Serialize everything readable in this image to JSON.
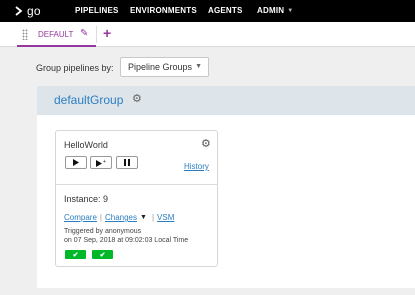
{
  "nav": {
    "logo_text": "go",
    "items": [
      "PIPELINES",
      "ENVIRONMENTS",
      "AGENTS"
    ],
    "admin_label": "ADMIN"
  },
  "tabs": {
    "default_label": "DEFAULT",
    "add_symbol": "+"
  },
  "group_by": {
    "label": "Group pipelines by:",
    "selected": "Pipeline Groups"
  },
  "group": {
    "name": "defaultGroup"
  },
  "pipeline": {
    "name": "HelloWorld",
    "history_label": "History",
    "instance_label": "Instance: 9",
    "links": {
      "compare": "Compare",
      "changes": "Changes",
      "vsm": "VSM"
    },
    "triggered_by": "Triggered by anonymous",
    "triggered_on": "on 07 Sep, 2018 at 09:02:03 Local Time",
    "stages": [
      {
        "status": "passed",
        "color": "#00b82a"
      },
      {
        "status": "passed",
        "color": "#00b82a"
      }
    ]
  },
  "colors": {
    "brand": "#943a9e",
    "link": "#2b7ec1",
    "nav_bg": "#000000",
    "passed": "#00b82a"
  }
}
